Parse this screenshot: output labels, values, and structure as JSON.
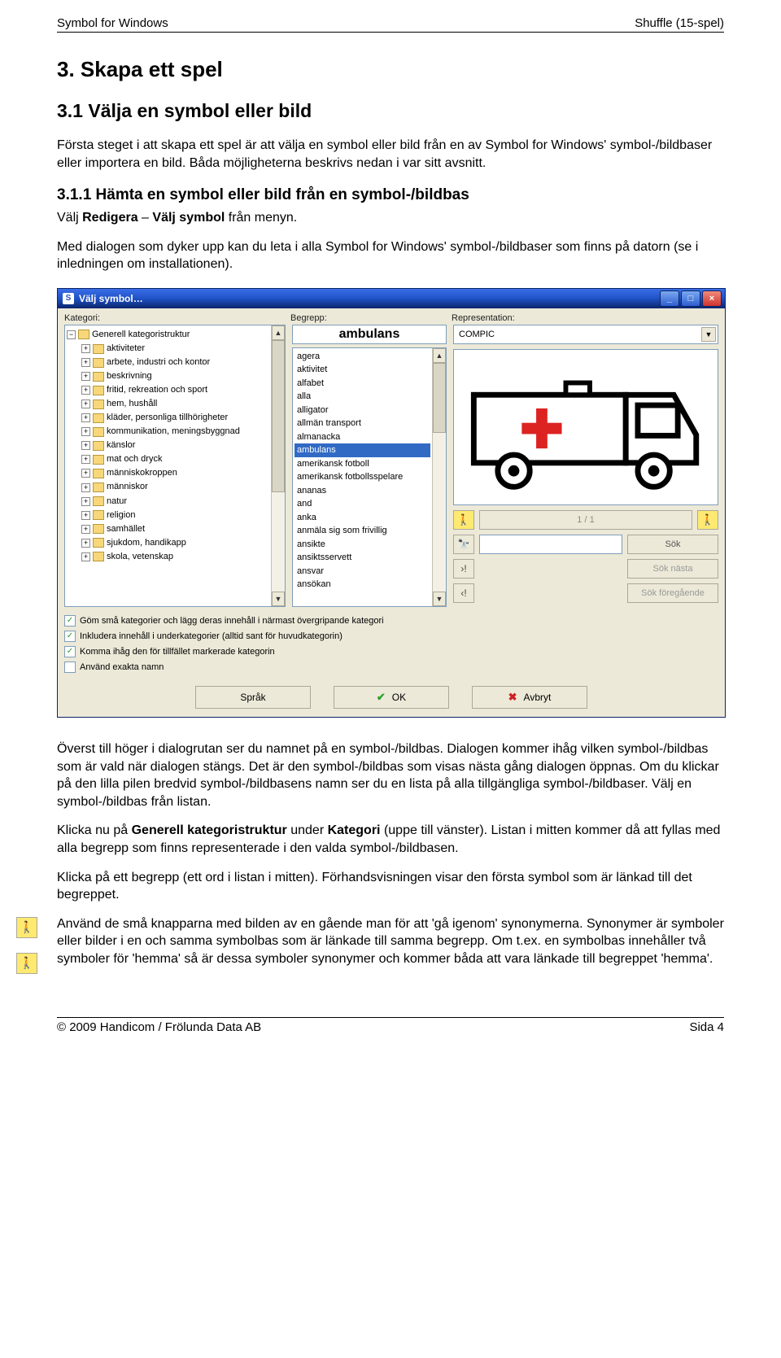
{
  "header": {
    "left": "Symbol for Windows",
    "right": "Shuffle (15-spel)"
  },
  "h1": "3.  Skapa ett spel",
  "h2": "3.1  Välja en symbol eller bild",
  "p1": "Första steget i att skapa ett spel är att välja en symbol eller bild från en av Symbol for Windows' symbol-/bildbaser eller importera en bild. Båda möjligheterna beskrivs nedan i var sitt avsnitt.",
  "h3": "3.1.1  Hämta en symbol eller bild från en symbol-/bildbas",
  "p2_pre": "Välj ",
  "p2_b1": "Redigera",
  "p2_mid": " – ",
  "p2_b2": "Välj symbol",
  "p2_post": " från menyn.",
  "p3": "Med dialogen som dyker upp kan du leta i alla Symbol for Windows' symbol-/bildbaser som finns på datorn (se i inledningen om installationen).",
  "dialog": {
    "title": "Välj symbol…",
    "labels": {
      "kategori": "Kategori:",
      "begrepp": "Begrepp:",
      "representation": "Representation:"
    },
    "tree_root": "Generell kategoristruktur",
    "tree": [
      "aktiviteter",
      "arbete, industri och kontor",
      "beskrivning",
      "fritid, rekreation och sport",
      "hem, hushåll",
      "kläder, personliga tillhörigheter",
      "kommunikation, meningsbyggnad",
      "känslor",
      "mat och dryck",
      "människokroppen",
      "människor",
      "natur",
      "religion",
      "samhället",
      "sjukdom, handikapp",
      "skola, vetenskap"
    ],
    "concept_selected": "ambulans",
    "concept_list": [
      "agera",
      "aktivitet",
      "alfabet",
      "alla",
      "alligator",
      "allmän transport",
      "almanacka",
      "ambulans",
      "amerikansk fotboll",
      "amerikansk fotbollsspelare",
      "ananas",
      "and",
      "anka",
      "anmäla sig som frivillig",
      "ansikte",
      "ansiktsservett",
      "ansvar",
      "ansökan"
    ],
    "representation_value": "COMPIC",
    "pager": "1 / 1",
    "search": {
      "btn": "Sök",
      "next": "Sök nästa",
      "prev": "Sök föregående"
    },
    "opts": [
      {
        "checked": true,
        "label": "Göm små kategorier och lägg deras innehåll i närmast övergripande kategori"
      },
      {
        "checked": true,
        "label": "Inkludera innehåll i underkategorier (alltid sant för huvudkategorin)"
      },
      {
        "checked": true,
        "label": "Komma ihåg den för tillfället markerade kategorin"
      },
      {
        "checked": false,
        "label": "Använd exakta namn"
      }
    ],
    "buttons": {
      "lang": "Språk",
      "ok": "OK",
      "cancel": "Avbryt"
    }
  },
  "p4": "Överst till höger i dialogrutan ser du namnet på en symbol-/bildbas. Dialogen kommer ihåg vilken symbol-/bildbas som är vald när dialogen stängs. Det är den symbol-/bildbas som visas nästa gång dialogen öppnas. Om du klickar på den lilla pilen bredvid symbol-/bildbasens namn ser du en lista på alla tillgängliga symbol-/bildbaser. Välj en symbol-/bildbas från listan.",
  "p5_pre": "Klicka nu på ",
  "p5_b1": "Generell kategoristruktur",
  "p5_mid": " under ",
  "p5_b2": "Kategori",
  "p5_post": " (uppe till vänster). Listan i mitten kommer då att fyllas med alla begrepp som finns representerade i den valda symbol-/bildbasen.",
  "p6": "Klicka på ett begrepp (ett ord i listan i mitten). Förhandsvisningen visar den första symbol som är länkad till det begreppet.",
  "p7": "Använd de små knapparna med bilden av en gående man för att 'gå igenom' synonymerna. Synonymer är symboler eller bilder i en och samma symbolbas som är länkade till samma begrepp. Om t.ex. en symbolbas innehåller två symboler för 'hemma' så är dessa symboler synonymer och kommer båda att vara länkade till begreppet 'hemma'.",
  "footer": {
    "left": "© 2009 Handicom / Frölunda Data AB",
    "right": "Sida 4"
  }
}
